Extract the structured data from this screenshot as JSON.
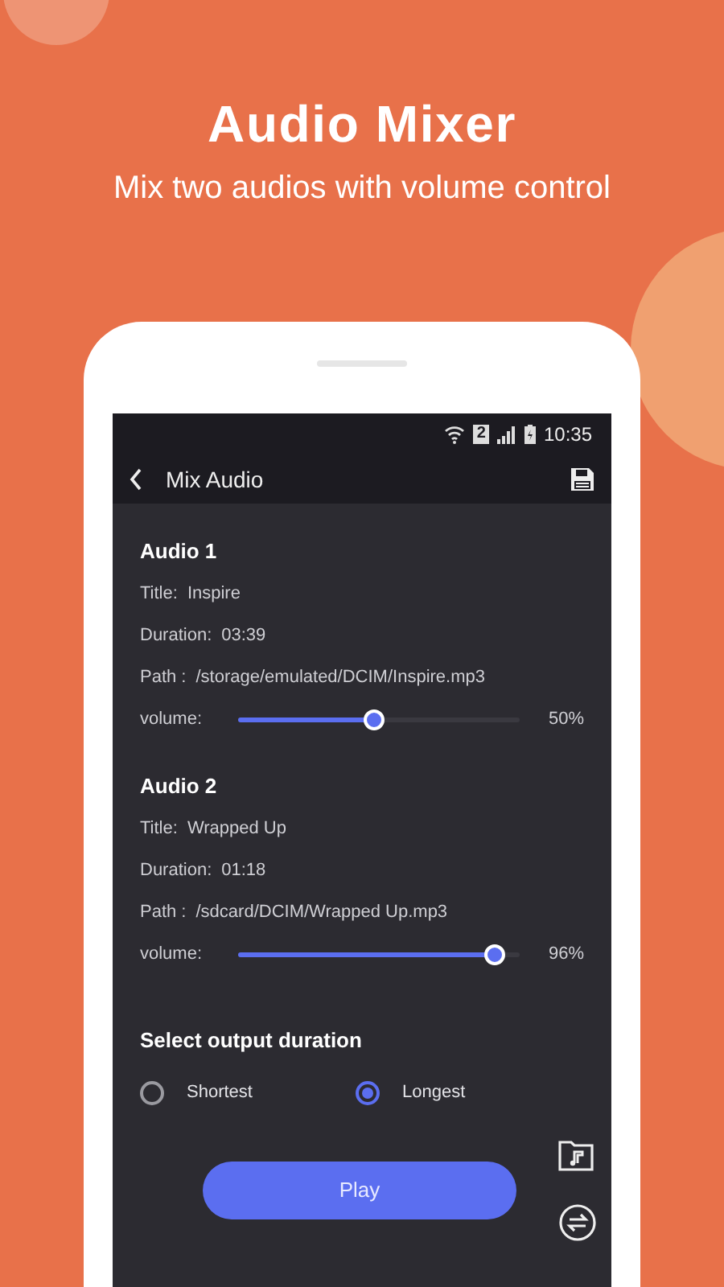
{
  "promo": {
    "title": "Audio Mixer",
    "subtitle": "Mix two audios with volume control"
  },
  "status_bar": {
    "sim_slot": "2",
    "time": "10:35"
  },
  "app_bar": {
    "title": "Mix Audio"
  },
  "audios": [
    {
      "heading": "Audio 1",
      "title_label": "Title:",
      "title": "Inspire",
      "duration_label": "Duration:",
      "duration": "03:39",
      "path_label": "Path :",
      "path": "/storage/emulated/DCIM/Inspire.mp3",
      "volume_label": "volume:",
      "level": 0.48,
      "reading": "50%"
    },
    {
      "heading": "Audio 2",
      "title_label": "Title:",
      "title": "Wrapped Up",
      "duration_label": "Duration:",
      "duration": "01:18",
      "path_label": "Path :",
      "path": "/sdcard/DCIM/Wrapped Up.mp3",
      "volume_label": "volume:",
      "level": 0.91,
      "reading": "96%"
    }
  ],
  "output": {
    "heading": "Select output duration",
    "options": [
      {
        "label": "Shortest",
        "selected": false
      },
      {
        "label": "Longest",
        "selected": true
      }
    ]
  },
  "play_button": "Play"
}
